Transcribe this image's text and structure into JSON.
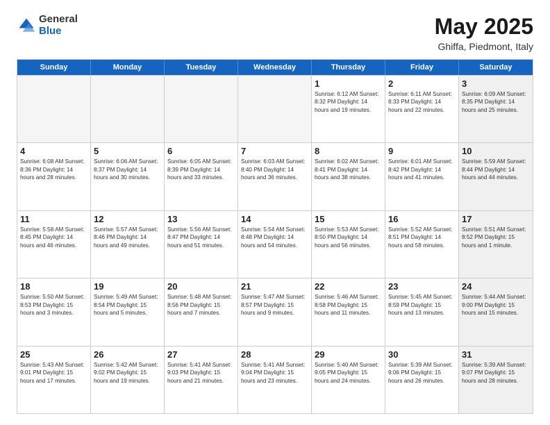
{
  "logo": {
    "general": "General",
    "blue": "Blue"
  },
  "header": {
    "title": "May 2025",
    "subtitle": "Ghiffa, Piedmont, Italy"
  },
  "days": [
    "Sunday",
    "Monday",
    "Tuesday",
    "Wednesday",
    "Thursday",
    "Friday",
    "Saturday"
  ],
  "weeks": [
    [
      {
        "day": "",
        "empty": true
      },
      {
        "day": "",
        "empty": true
      },
      {
        "day": "",
        "empty": true
      },
      {
        "day": "",
        "empty": true
      },
      {
        "day": "1",
        "info": "Sunrise: 6:12 AM\nSunset: 8:32 PM\nDaylight: 14 hours\nand 19 minutes."
      },
      {
        "day": "2",
        "info": "Sunrise: 6:11 AM\nSunset: 8:33 PM\nDaylight: 14 hours\nand 22 minutes."
      },
      {
        "day": "3",
        "shaded": true,
        "info": "Sunrise: 6:09 AM\nSunset: 8:35 PM\nDaylight: 14 hours\nand 25 minutes."
      }
    ],
    [
      {
        "day": "4",
        "info": "Sunrise: 6:08 AM\nSunset: 8:36 PM\nDaylight: 14 hours\nand 28 minutes."
      },
      {
        "day": "5",
        "info": "Sunrise: 6:06 AM\nSunset: 8:37 PM\nDaylight: 14 hours\nand 30 minutes."
      },
      {
        "day": "6",
        "info": "Sunrise: 6:05 AM\nSunset: 8:39 PM\nDaylight: 14 hours\nand 33 minutes."
      },
      {
        "day": "7",
        "info": "Sunrise: 6:03 AM\nSunset: 8:40 PM\nDaylight: 14 hours\nand 36 minutes."
      },
      {
        "day": "8",
        "info": "Sunrise: 6:02 AM\nSunset: 8:41 PM\nDaylight: 14 hours\nand 38 minutes."
      },
      {
        "day": "9",
        "info": "Sunrise: 6:01 AM\nSunset: 8:42 PM\nDaylight: 14 hours\nand 41 minutes."
      },
      {
        "day": "10",
        "shaded": true,
        "info": "Sunrise: 5:59 AM\nSunset: 8:44 PM\nDaylight: 14 hours\nand 44 minutes."
      }
    ],
    [
      {
        "day": "11",
        "info": "Sunrise: 5:58 AM\nSunset: 8:45 PM\nDaylight: 14 hours\nand 46 minutes."
      },
      {
        "day": "12",
        "info": "Sunrise: 5:57 AM\nSunset: 8:46 PM\nDaylight: 14 hours\nand 49 minutes."
      },
      {
        "day": "13",
        "info": "Sunrise: 5:56 AM\nSunset: 8:47 PM\nDaylight: 14 hours\nand 51 minutes."
      },
      {
        "day": "14",
        "info": "Sunrise: 5:54 AM\nSunset: 8:48 PM\nDaylight: 14 hours\nand 54 minutes."
      },
      {
        "day": "15",
        "info": "Sunrise: 5:53 AM\nSunset: 8:50 PM\nDaylight: 14 hours\nand 56 minutes."
      },
      {
        "day": "16",
        "info": "Sunrise: 5:52 AM\nSunset: 8:51 PM\nDaylight: 14 hours\nand 58 minutes."
      },
      {
        "day": "17",
        "shaded": true,
        "info": "Sunrise: 5:51 AM\nSunset: 8:52 PM\nDaylight: 15 hours\nand 1 minute."
      }
    ],
    [
      {
        "day": "18",
        "info": "Sunrise: 5:50 AM\nSunset: 8:53 PM\nDaylight: 15 hours\nand 3 minutes."
      },
      {
        "day": "19",
        "info": "Sunrise: 5:49 AM\nSunset: 8:54 PM\nDaylight: 15 hours\nand 5 minutes."
      },
      {
        "day": "20",
        "info": "Sunrise: 5:48 AM\nSunset: 8:56 PM\nDaylight: 15 hours\nand 7 minutes."
      },
      {
        "day": "21",
        "info": "Sunrise: 5:47 AM\nSunset: 8:57 PM\nDaylight: 15 hours\nand 9 minutes."
      },
      {
        "day": "22",
        "info": "Sunrise: 5:46 AM\nSunset: 8:58 PM\nDaylight: 15 hours\nand 11 minutes."
      },
      {
        "day": "23",
        "info": "Sunrise: 5:45 AM\nSunset: 8:59 PM\nDaylight: 15 hours\nand 13 minutes."
      },
      {
        "day": "24",
        "shaded": true,
        "info": "Sunrise: 5:44 AM\nSunset: 9:00 PM\nDaylight: 15 hours\nand 15 minutes."
      }
    ],
    [
      {
        "day": "25",
        "info": "Sunrise: 5:43 AM\nSunset: 9:01 PM\nDaylight: 15 hours\nand 17 minutes."
      },
      {
        "day": "26",
        "info": "Sunrise: 5:42 AM\nSunset: 9:02 PM\nDaylight: 15 hours\nand 19 minutes."
      },
      {
        "day": "27",
        "info": "Sunrise: 5:41 AM\nSunset: 9:03 PM\nDaylight: 15 hours\nand 21 minutes."
      },
      {
        "day": "28",
        "info": "Sunrise: 5:41 AM\nSunset: 9:04 PM\nDaylight: 15 hours\nand 23 minutes."
      },
      {
        "day": "29",
        "info": "Sunrise: 5:40 AM\nSunset: 9:05 PM\nDaylight: 15 hours\nand 24 minutes."
      },
      {
        "day": "30",
        "info": "Sunrise: 5:39 AM\nSunset: 9:06 PM\nDaylight: 15 hours\nand 26 minutes."
      },
      {
        "day": "31",
        "shaded": true,
        "info": "Sunrise: 5:39 AM\nSunset: 9:07 PM\nDaylight: 15 hours\nand 28 minutes."
      }
    ]
  ]
}
